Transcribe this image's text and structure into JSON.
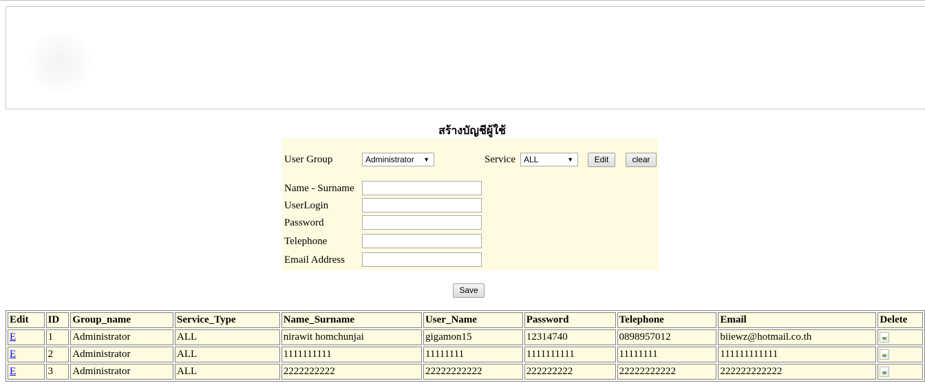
{
  "page": {
    "title": "สร้างบัญชีผู้ใช้"
  },
  "form": {
    "user_group_label": "User Group",
    "user_group_value": "Administrator",
    "service_label": "Service",
    "service_value": "ALL",
    "edit_button": "Edit",
    "clear_button": "clear",
    "name_label": "Name - Surname",
    "login_label": "UserLogin",
    "password_label": "Password",
    "telephone_label": "Telephone",
    "email_label": "Email Address",
    "save_button": "Save",
    "name_value": "",
    "login_value": "",
    "password_value": "",
    "telephone_value": "",
    "email_value": ""
  },
  "table": {
    "headers": [
      "Edit",
      "ID",
      "Group_name",
      "Service_Type",
      "Name_Surname",
      "User_Name",
      "Password",
      "Telephone",
      "Email",
      "Delete"
    ],
    "rows": [
      {
        "edit": "E",
        "id": "1",
        "group": "Administrator",
        "service": "ALL",
        "name": "nirawit homchunjai",
        "user": "gigamon15",
        "password": "12314740",
        "telephone": "0898957012",
        "email": "biiewz@hotmail.co.th"
      },
      {
        "edit": "E",
        "id": "2",
        "group": "Administrator",
        "service": "ALL",
        "name": "1111111111",
        "user": "11111111",
        "password": "1111111111",
        "telephone": "11111111",
        "email": "111111111111"
      },
      {
        "edit": "E",
        "id": "3",
        "group": "Administrator",
        "service": "ALL",
        "name": "2222222222",
        "user": "22222222222",
        "password": "222222222",
        "telephone": "22222222222",
        "email": "222222222222"
      }
    ]
  },
  "icons": {
    "delete": "broken-image-icon"
  }
}
